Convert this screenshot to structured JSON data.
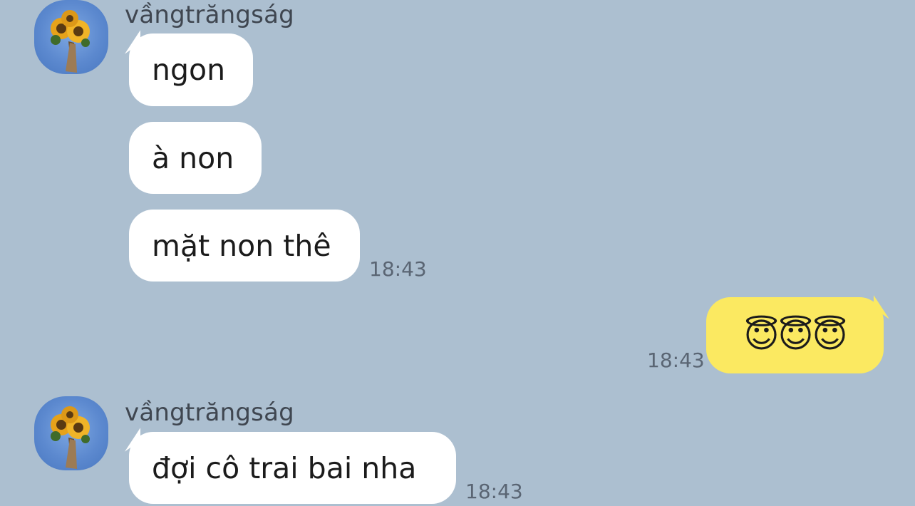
{
  "messages": [
    {
      "sender": "vầngtrăngság",
      "bubbles": [
        "ngon",
        "à non",
        "mặt non thê"
      ],
      "time": "18:43"
    },
    {
      "outgoing_text": "😇😇😇",
      "time": "18:43"
    },
    {
      "sender": "vầngtrăngság",
      "bubbles": [
        "đợi cô trai bai nha"
      ],
      "time": "18:43"
    }
  ],
  "icons": {
    "avatar": "sunflower-avatar-icon"
  },
  "colors": {
    "background": "#acbfd0",
    "incoming_bubble": "#ffffff",
    "outgoing_bubble": "#fbe961"
  }
}
